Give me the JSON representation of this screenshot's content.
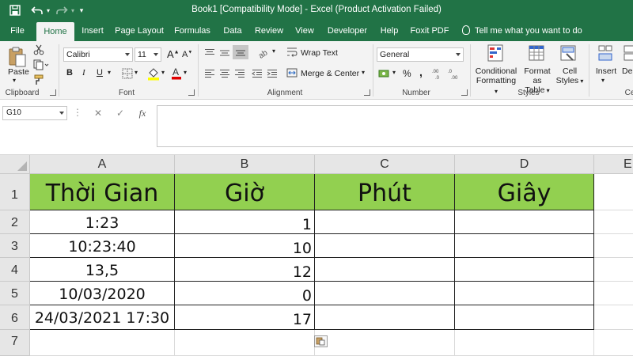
{
  "window": {
    "title": "Book1  [Compatibility Mode]  -  Excel (Product Activation Failed)",
    "accent": "#217346"
  },
  "menu": {
    "tabs": [
      "File",
      "Home",
      "Insert",
      "Page Layout",
      "Formulas",
      "Data",
      "Review",
      "View",
      "Developer",
      "Help",
      "Foxit PDF"
    ],
    "active": "Home",
    "tell_me": "Tell me what you want to do"
  },
  "ribbon": {
    "clipboard": {
      "label": "Clipboard",
      "paste": "Paste"
    },
    "font": {
      "label": "Font",
      "name": "Calibri",
      "size": "11",
      "bold": "B",
      "italic": "I",
      "underline": "U"
    },
    "alignment": {
      "label": "Alignment",
      "wrap_text": "Wrap Text",
      "merge_center": "Merge & Center"
    },
    "number": {
      "label": "Number",
      "format": "General",
      "percent": "%"
    },
    "styles": {
      "label": "Styles",
      "conditional_line1": "Conditional",
      "conditional_line2": "Formatting",
      "format_table_line1": "Format as",
      "format_table_line2": "Table",
      "cell_styles_line1": "Cell",
      "cell_styles_line2": "Styles"
    },
    "cells": {
      "label": "Ce",
      "insert": "Insert",
      "delete": "Del"
    }
  },
  "formula_bar": {
    "name_box": "G10",
    "cancel_icon": "✕",
    "enter_icon": "✓",
    "fx_label": "fx",
    "value": ""
  },
  "sheet": {
    "columns": [
      "A",
      "B",
      "C",
      "D",
      "E"
    ],
    "rows": [
      "1",
      "2",
      "3",
      "4",
      "5",
      "6",
      "7"
    ],
    "header_fill": "#92d050",
    "header_cells": [
      "Thời Gian",
      "Giờ",
      "Phút",
      "Giây"
    ],
    "data": [
      {
        "a": "1:23",
        "b": "1"
      },
      {
        "a": "10:23:40",
        "b": "10"
      },
      {
        "a": "13,5",
        "b": "12"
      },
      {
        "a": "10/03/2020",
        "b": "0"
      },
      {
        "a": "24/03/2021 17:30",
        "b": "17"
      }
    ]
  }
}
